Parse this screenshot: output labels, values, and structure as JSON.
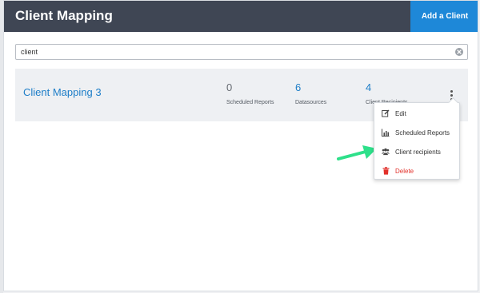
{
  "header": {
    "title": "Client Mapping",
    "add_button_label": "Add a Client"
  },
  "search": {
    "value": "client",
    "clear_icon": "clear-circle-icon"
  },
  "client_card": {
    "name": "Client Mapping 3",
    "stats": [
      {
        "value": "0",
        "label": "Scheduled Reports"
      },
      {
        "value": "6",
        "label": "Datasources"
      },
      {
        "value": "4",
        "label": "Client Recipients"
      }
    ],
    "menu_icon": "kebab-menu-icon"
  },
  "dropdown_menu": {
    "items": [
      {
        "label": "Edit",
        "icon": "edit-icon"
      },
      {
        "label": "Scheduled Reports",
        "icon": "bar-chart-icon"
      },
      {
        "label": "Client recipients",
        "icon": "users-icon"
      },
      {
        "label": "Delete",
        "icon": "trash-icon"
      }
    ]
  },
  "colors": {
    "header_bg": "#3f4654",
    "accent_blue": "#1e88d8",
    "link_blue": "#1e7ec8",
    "delete_red": "#e2312b",
    "arrow_green": "#2ee08a"
  }
}
